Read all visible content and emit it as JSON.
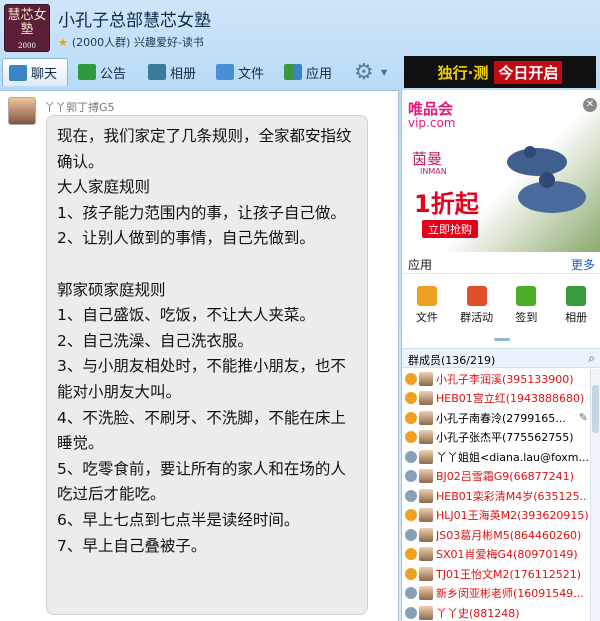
{
  "window": {
    "logo_text": "慧芯女塾",
    "logo_year": "2000",
    "title": "小孔子总部慧芯女塾",
    "subtitle": "(2000人群) 兴趣爱好-读书"
  },
  "toolbar": {
    "chat": "聊天",
    "notice": "公告",
    "album": "相册",
    "file": "文件",
    "apps": "应用"
  },
  "top_ad": {
    "part1": "独行·测",
    "part2": "今日开启"
  },
  "chat": {
    "sender": "丫丫郭丁搏G5",
    "message": "现在，我们家定了几条规则，全家都安指纹确认。\n大人家庭规则\n1、孩子能力范围内的事，让孩子自己做。\n2、让别人做到的事情，自己先做到。\n\n郭家硕家庭规则\n1、自己盛饭、吃饭，不让大人夹菜。\n2、自己洗澡、自己洗衣服。\n3、与小朋友相处时，不能推小朋友，也不能对小朋友大叫。\n4、不洗脸、不刷牙、不洗脚，不能在床上睡觉。\n5、吃零食前，要让所有的家人和在场的人吃过后才能吃。\n6、早上七点到七点半是读经时间。\n7、早上自己叠被子。"
  },
  "right_ad": {
    "vip_cn": "唯品会",
    "vip_url": "vip.com",
    "brand_cn": "茵曼",
    "brand_en": "INMAN",
    "sale": "1折起",
    "buy": "立即抢购"
  },
  "apps_panel": {
    "title": "应用",
    "more": "更多",
    "items": [
      {
        "label": "文件",
        "color": "#f0a020"
      },
      {
        "label": "群活动",
        "color": "#e0502a"
      },
      {
        "label": "签到",
        "color": "#4caf2a"
      },
      {
        "label": "相册",
        "color": "#3a9a3a"
      }
    ]
  },
  "members": {
    "header": "群成员(136/219)",
    "list": [
      {
        "name": "小孔子李润溪(395133900)",
        "color": "#e01010",
        "rank": "#f0a020"
      },
      {
        "name": "HEB01宫立红(1943888680)",
        "color": "#e01010",
        "rank": "#f0a020"
      },
      {
        "name": "小孔子南春泠(2799165...",
        "color": "#000000",
        "rank": "#f0a020"
      },
      {
        "name": "小孔子张杰平(775562755)",
        "color": "#000000",
        "rank": "#f0a020"
      },
      {
        "name": "丫丫姐姐<diana.lau@foxm...",
        "color": "#000000",
        "rank": "#8aa0b8"
      },
      {
        "name": "BJ02吕雪霜G9(66877241)",
        "color": "#e01010",
        "rank": "#8aa0b8"
      },
      {
        "name": "HEB01栾彩清M4岁(635125...",
        "color": "#e01010",
        "rank": "#8aa0b8"
      },
      {
        "name": "HLJ01王海英M2(393620915)",
        "color": "#e01010",
        "rank": "#f0a020"
      },
      {
        "name": "JS03葛月彬M5(864460260)",
        "color": "#e01010",
        "rank": "#8aa0b8"
      },
      {
        "name": "SX01肖爱梅G4(80970149)",
        "color": "#e01010",
        "rank": "#f0a020"
      },
      {
        "name": "TJ01王怡文M2(176112521)",
        "color": "#e01010",
        "rank": "#f0a020"
      },
      {
        "name": "新乡闵亚彬老师(16091549...",
        "color": "#e01010",
        "rank": "#8aa0b8"
      },
      {
        "name": "丫丫史(881248)",
        "color": "#e01010",
        "rank": "#8aa0b8"
      }
    ]
  }
}
